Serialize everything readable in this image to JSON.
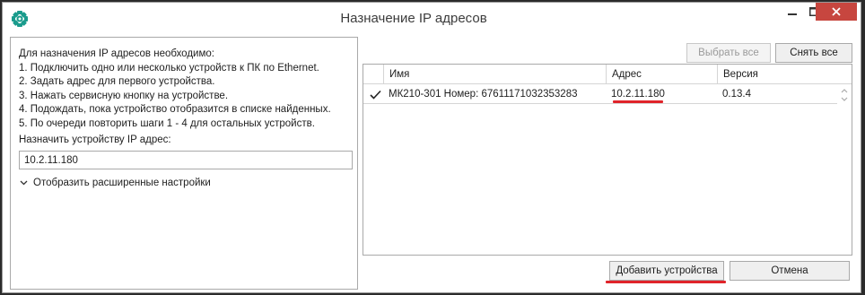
{
  "window": {
    "title": "Назначение IP адресов"
  },
  "instructions": {
    "lines": [
      "Для назначения IP адресов необходимо:",
      "1. Подключить одно или несколько устройств к ПК по Ethernet.",
      "2. Задать адрес для первого устройства.",
      "3. Нажать сервисную кнопку на устройстве.",
      "4. Подождать, пока устройство отобразится в списке найденных.",
      "5. По очереди повторить шаги 1 - 4 для остальных устройств."
    ]
  },
  "assign": {
    "label": "Назначить устройству IP адрес:",
    "value": "10.2.11.180"
  },
  "advanced": {
    "label": "Отобразить расширенные настройки"
  },
  "buttons": {
    "select_all": "Выбрать все",
    "deselect_all": "Снять все",
    "add_devices": "Добавить устройства",
    "cancel": "Отмена"
  },
  "table": {
    "columns": [
      "Имя",
      "Адрес",
      "Версия"
    ],
    "rows": [
      {
        "checked": true,
        "name": "МК210-301 Номер: 67611171032353283",
        "address": "10.2.11.180",
        "version": "0.13.4"
      }
    ]
  },
  "colors": {
    "close_button": "#c7463f",
    "annotation_underline": "#e0242a",
    "app_icon": "#1a9b8c"
  },
  "icons": {
    "app": "owl-logo-icon",
    "minimize": "minimize-icon",
    "maximize": "maximize-icon",
    "close": "close-icon",
    "expand": "chevron-down-icon",
    "checkbox": "checkmark-icon"
  }
}
